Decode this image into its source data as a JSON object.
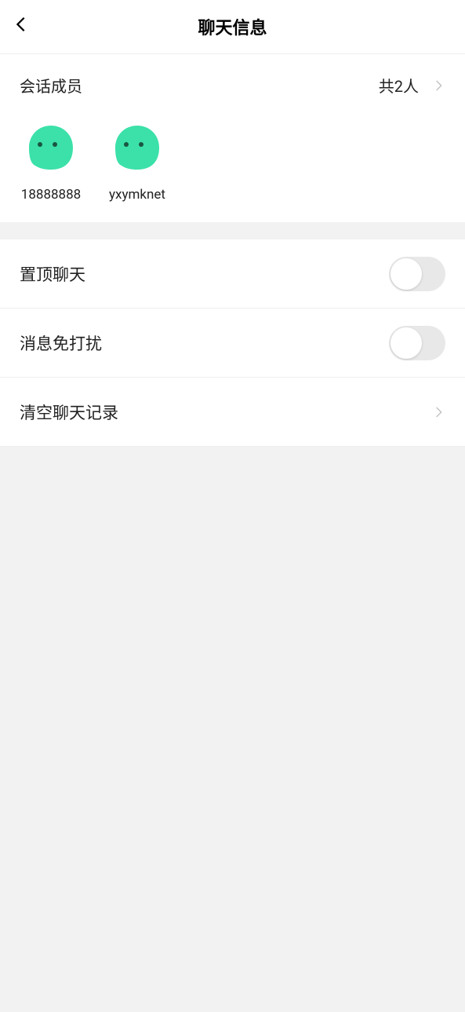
{
  "header": {
    "title": "聊天信息"
  },
  "members": {
    "label": "会话成员",
    "count_text": "共2人",
    "list": [
      {
        "nick": "18888888"
      },
      {
        "nick": "yxymknet"
      }
    ]
  },
  "settings": {
    "pin_label": "置顶聊天",
    "mute_label": "消息免打扰",
    "clear_label": "清空聊天记录"
  }
}
